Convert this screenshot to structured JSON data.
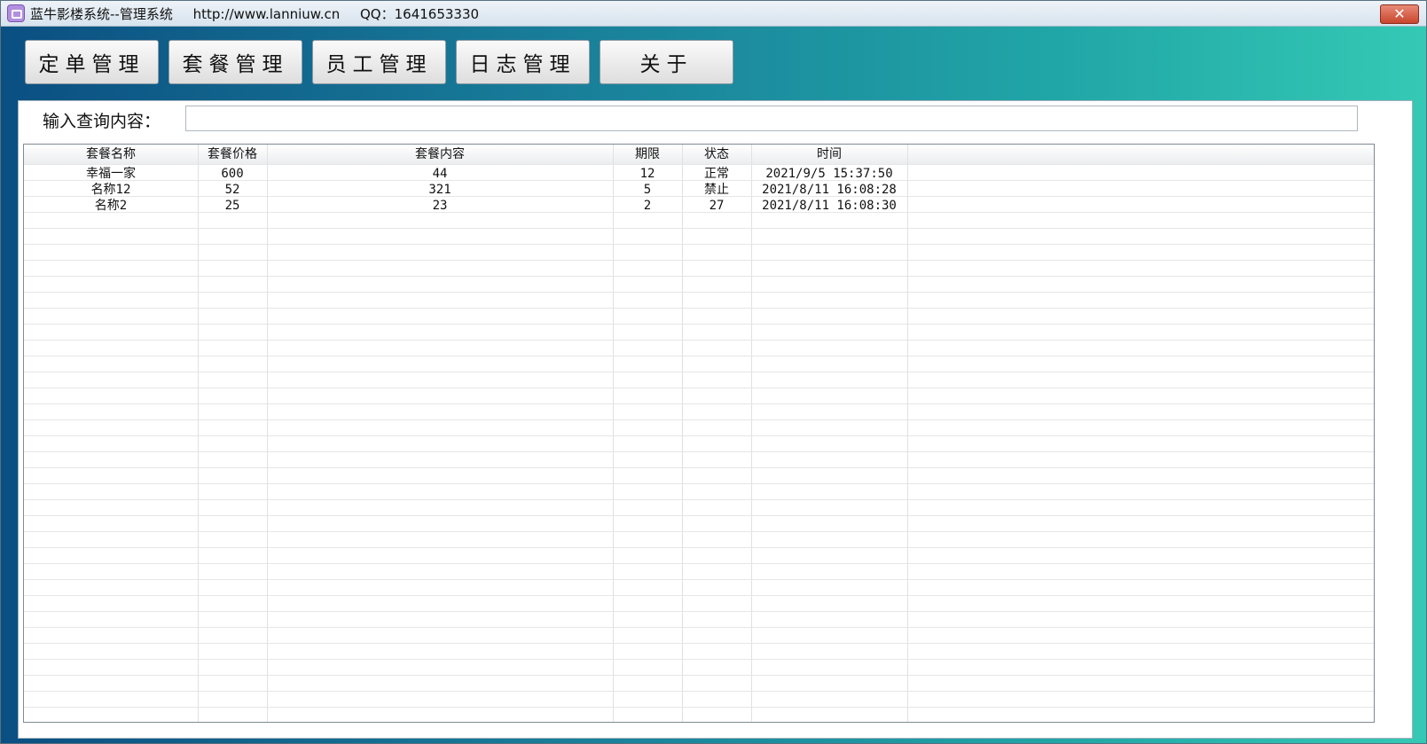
{
  "window": {
    "title": "蓝牛影楼系统--管理系统",
    "url": "http://www.lanniuw.cn",
    "qq": "QQ：1641653330",
    "close_label": "✕"
  },
  "toolbar": {
    "buttons": [
      "定单管理",
      "套餐管理",
      "员工管理",
      "日志管理",
      "关于"
    ]
  },
  "search": {
    "label": "输入查询内容：",
    "value": ""
  },
  "table": {
    "headers": [
      "套餐名称",
      "套餐价格",
      "套餐内容",
      "期限",
      "状态",
      "时间"
    ],
    "rows": [
      [
        "幸福一家",
        "600",
        "44",
        "12",
        "正常",
        "2021/9/5 15:37:50"
      ],
      [
        "名称12",
        "52",
        "321",
        "5",
        "禁止",
        "2021/8/11 16:08:28"
      ],
      [
        "名称2",
        "25",
        "23",
        "2",
        "27",
        "2021/8/11 16:08:30"
      ]
    ]
  }
}
